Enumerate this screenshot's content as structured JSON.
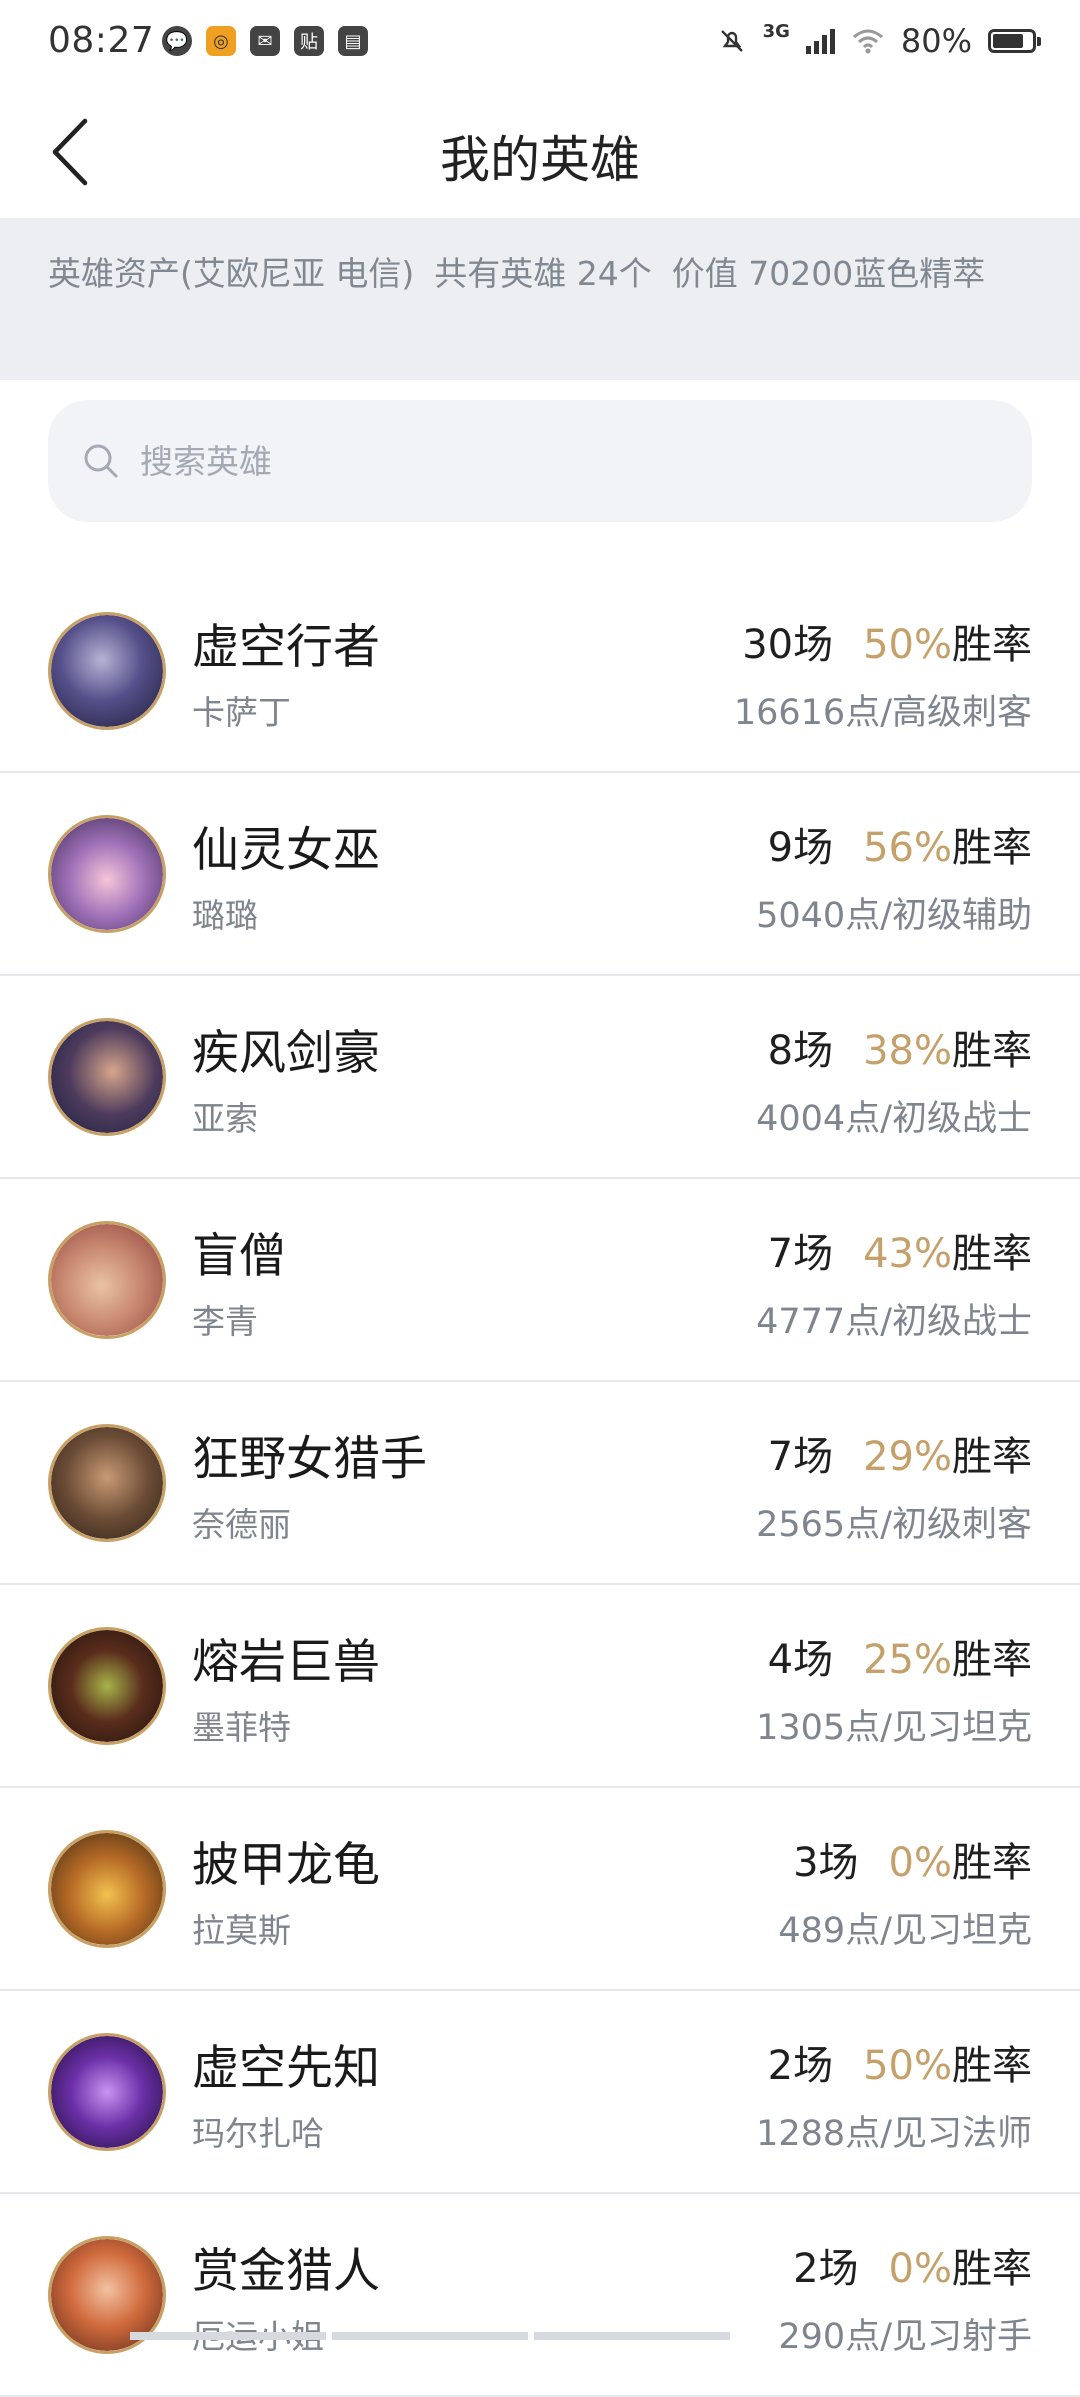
{
  "status_bar": {
    "time": "08:27",
    "notification_icons": [
      "chat-icon",
      "game-icon",
      "mail-icon",
      "tieba-icon",
      "book-icon"
    ],
    "notification_glyphs": [
      "💬",
      "◎",
      "✉",
      "贴",
      "▤"
    ],
    "network": "3G",
    "battery": "80%",
    "battery_level": 0.8
  },
  "header": {
    "title": "我的英雄"
  },
  "info": {
    "assets": "英雄资产(艾欧尼亚 电信)",
    "count": "共有英雄 24个",
    "value": "价值 70200蓝色精萃"
  },
  "search": {
    "placeholder": "搜索英雄"
  },
  "heroes": [
    {
      "name": "虚空行者",
      "sub": "卡萨丁",
      "games": "30场",
      "rate": "50%",
      "rate_label": "胜率",
      "points": "16616点/高级刺客"
    },
    {
      "name": "仙灵女巫",
      "sub": "璐璐",
      "games": "9场",
      "rate": "56%",
      "rate_label": "胜率",
      "points": "5040点/初级辅助"
    },
    {
      "name": "疾风剑豪",
      "sub": "亚索",
      "games": "8场",
      "rate": "38%",
      "rate_label": "胜率",
      "points": "4004点/初级战士"
    },
    {
      "name": "盲僧",
      "sub": "李青",
      "games": "7场",
      "rate": "43%",
      "rate_label": "胜率",
      "points": "4777点/初级战士"
    },
    {
      "name": "狂野女猎手",
      "sub": "奈德丽",
      "games": "7场",
      "rate": "29%",
      "rate_label": "胜率",
      "points": "2565点/初级刺客"
    },
    {
      "name": "熔岩巨兽",
      "sub": "墨菲特",
      "games": "4场",
      "rate": "25%",
      "rate_label": "胜率",
      "points": "1305点/见习坦克"
    },
    {
      "name": "披甲龙龟",
      "sub": "拉莫斯",
      "games": "3场",
      "rate": "0%",
      "rate_label": "胜率",
      "points": "489点/见习坦克"
    },
    {
      "name": "虚空先知",
      "sub": "玛尔扎哈",
      "games": "2场",
      "rate": "50%",
      "rate_label": "胜率",
      "points": "1288点/见习法师"
    },
    {
      "name": "赏金猎人",
      "sub": "厄运小姐",
      "games": "2场",
      "rate": "0%",
      "rate_label": "胜率",
      "points": "290点/见习射手"
    }
  ],
  "colors": {
    "accent_rate": "#c5a06a",
    "info_band": "#eceef2",
    "avatar_ring": "#c9a063"
  }
}
